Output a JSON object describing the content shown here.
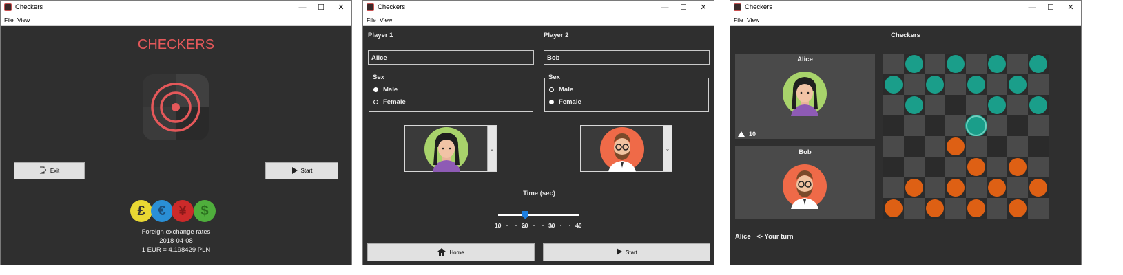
{
  "windows": [
    {
      "title": "Checkers",
      "menu": [
        "File",
        "View"
      ]
    },
    {
      "title": "Checkers",
      "menu": [
        "File",
        "View"
      ]
    },
    {
      "title": "Checkers",
      "menu": [
        "File",
        "View"
      ]
    }
  ],
  "controls": {
    "minimize": "—",
    "maximize": "☐",
    "close": "✕"
  },
  "home": {
    "title": "CHECKERS",
    "exit_label": "Exit",
    "start_label": "Start",
    "currency_symbols": [
      "£",
      "€",
      "¥",
      "$"
    ],
    "fx_title": "Foreign exchange rates",
    "fx_date": "2018-04-08",
    "fx_rate": "1 EUR = 4.198429 PLN"
  },
  "setup": {
    "player1_label": "Player 1",
    "player2_label": "Player 2",
    "player1_name": "Alice",
    "player2_name": "Bob",
    "sex_label": "Sex",
    "male_label": "Male",
    "female_label": "Female",
    "player1_sex": "Female",
    "player2_sex": "Male",
    "time_label": "Time (sec)",
    "time_ticks": [
      "10",
      "20",
      "30",
      "40"
    ],
    "time_min": 10,
    "time_max": 40,
    "time_value": 20,
    "home_label": "Home",
    "start_label": "Start"
  },
  "game": {
    "title": "Checkers",
    "player1": "Alice",
    "player2": "Bob",
    "timer": "10",
    "status_player": "Alice",
    "status_text": "<- Your turn",
    "colors": {
      "light": "#4a4a4a",
      "dark": "#2b2b2b",
      "teal": "#1a9e8a",
      "orange": "#de6014",
      "highlight": "#d13a3a"
    },
    "board": [
      "_T_T_T_T",
      "T_T_T_T_",
      "_T___T_T",
      "____S___",
      "___O____",
      "__X_O_O_",
      "_O_O_O_O",
      "O_O_O_O_"
    ]
  }
}
